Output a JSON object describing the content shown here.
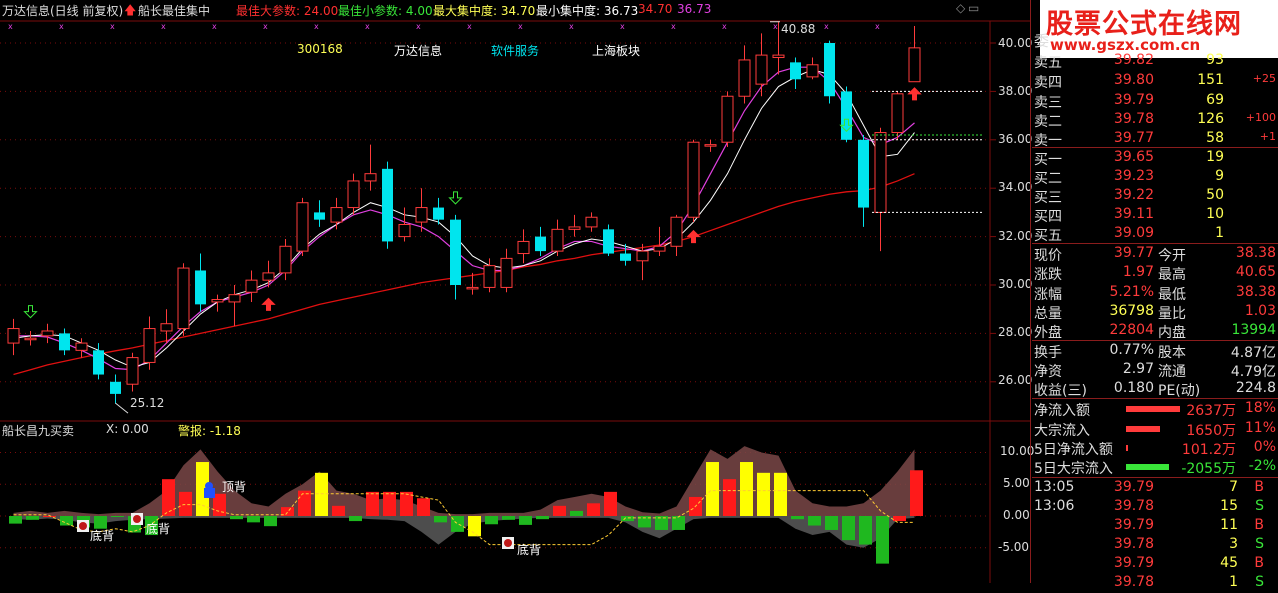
{
  "header": {
    "title": "万达信息(日线 前复权)",
    "formula": "船长最佳集中",
    "params": [
      {
        "label": "最佳大参数:",
        "value": "24.00",
        "color": "#ff3030"
      },
      {
        "label": "最佳小参数:",
        "value": "4.00",
        "color": "#39e639"
      },
      {
        "label": "最大集中度:",
        "value": "34.70",
        "color": "#ffff55"
      },
      {
        "label": "最小集中度:",
        "value": "36.73",
        "color": "#ffffff"
      }
    ],
    "extra_values": [
      "34.70",
      "36.73"
    ]
  },
  "info_row": {
    "code": "300168",
    "name": "万达信息",
    "industry": "软件服务",
    "region": "上海板块"
  },
  "price_labels": {
    "high": "40.88",
    "low": "25.12"
  },
  "y_axis_main": [
    "40.00",
    "38.00",
    "36.00",
    "34.00",
    "32.00",
    "30.00",
    "28.00",
    "26.00"
  ],
  "sub_chart": {
    "title": "船长昌九买卖",
    "x_label": "X: 0.00",
    "alert_label": "警报:",
    "alert_value": "-1.18",
    "y_axis": [
      "10.00",
      "5.00",
      "0.00",
      "-5.00"
    ],
    "annotations": {
      "top": "顶背",
      "bottom": "底背"
    }
  },
  "order_book": {
    "title": "委",
    "sells": [
      {
        "label": "卖五",
        "price": "39.82",
        "vol": "93",
        "chg": ""
      },
      {
        "label": "卖四",
        "price": "39.80",
        "vol": "151",
        "chg": "+25"
      },
      {
        "label": "卖三",
        "price": "39.79",
        "vol": "69",
        "chg": ""
      },
      {
        "label": "卖二",
        "price": "39.78",
        "vol": "126",
        "chg": "+100"
      },
      {
        "label": "卖一",
        "price": "39.77",
        "vol": "58",
        "chg": "+1"
      }
    ],
    "buys": [
      {
        "label": "买一",
        "price": "39.65",
        "vol": "19"
      },
      {
        "label": "买二",
        "price": "39.23",
        "vol": "9"
      },
      {
        "label": "买三",
        "price": "39.22",
        "vol": "50"
      },
      {
        "label": "买四",
        "price": "39.11",
        "vol": "10"
      },
      {
        "label": "买五",
        "price": "39.09",
        "vol": "1"
      }
    ]
  },
  "quote": [
    {
      "l1": "现价",
      "v1": "39.77",
      "l2": "今开",
      "v2": "38.38",
      "c1": "#ff3b3b",
      "c2": "#ff3b3b"
    },
    {
      "l1": "涨跌",
      "v1": "1.97",
      "l2": "最高",
      "v2": "40.65",
      "c1": "#ff3b3b",
      "c2": "#ff3b3b"
    },
    {
      "l1": "涨幅",
      "v1": "5.21%",
      "l2": "最低",
      "v2": "38.38",
      "c1": "#ff3b3b",
      "c2": "#ff3b3b"
    },
    {
      "l1": "总量",
      "v1": "36798",
      "l2": "量比",
      "v2": "1.03",
      "c1": "#ffff55",
      "c2": "#ff3b3b"
    },
    {
      "l1": "外盘",
      "v1": "22804",
      "l2": "内盘",
      "v2": "13994",
      "c1": "#ff3b3b",
      "c2": "#39e639"
    }
  ],
  "fundamentals": [
    {
      "l1": "换手",
      "v1": "0.77%",
      "l2": "股本",
      "v2": "4.87亿"
    },
    {
      "l1": "净资",
      "v1": "2.97",
      "l2": "流通",
      "v2": "4.79亿"
    },
    {
      "l1": "收益(三)",
      "v1": "0.180",
      "l2": "PE(动)",
      "v2": "224.8"
    }
  ],
  "flows": [
    {
      "label": "净流入额",
      "value": "2637万",
      "pct": "18%",
      "color": "#ff3b3b",
      "bar": 0.75
    },
    {
      "label": "大宗流入",
      "value": "1650万",
      "pct": "11%",
      "color": "#ff3b3b",
      "bar": 0.47
    },
    {
      "label": "5日净流入额",
      "value": "101.2万",
      "pct": "0%",
      "color": "#ff3b3b",
      "bar": 0.03
    },
    {
      "label": "5日大宗流入",
      "value": "-2055万",
      "pct": "-2%",
      "color": "#39e639",
      "bar": 0.6
    }
  ],
  "ticks": [
    {
      "time": "13:05",
      "price": "39.79",
      "vol": "7",
      "side": "B"
    },
    {
      "time": "13:06",
      "price": "39.78",
      "vol": "15",
      "side": "S"
    },
    {
      "time": "",
      "price": "39.79",
      "vol": "11",
      "side": "B"
    },
    {
      "time": "",
      "price": "39.78",
      "vol": "3",
      "side": "S"
    },
    {
      "time": "",
      "price": "39.79",
      "vol": "45",
      "side": "B"
    },
    {
      "time": "",
      "price": "39.78",
      "vol": "1",
      "side": "S"
    }
  ],
  "watermark": {
    "line1": "股票公式在线网",
    "line2": "www.gszx.com.cn"
  },
  "colors": {
    "up": "#ff3b3b",
    "down": "#00e5ee",
    "ma_long": "#e01010",
    "ma_short": "#ffffff",
    "ma_mid": "#e040e0",
    "grid": "#7a0c0c"
  },
  "chart_data": {
    "type": "candlestick",
    "y_range": [
      25.12,
      40.88
    ],
    "candles": [
      {
        "o": 27.6,
        "c": 28.2,
        "h": 28.6,
        "l": 27.1
      },
      {
        "o": 27.8,
        "c": 27.8,
        "h": 28.1,
        "l": 27.5
      },
      {
        "o": 27.9,
        "c": 28.1,
        "h": 28.4,
        "l": 27.6
      },
      {
        "o": 28.0,
        "c": 27.3,
        "h": 28.2,
        "l": 27.1
      },
      {
        "o": 27.3,
        "c": 27.6,
        "h": 27.8,
        "l": 27.0
      },
      {
        "o": 27.3,
        "c": 26.3,
        "h": 27.6,
        "l": 26.1
      },
      {
        "o": 26.0,
        "c": 25.5,
        "h": 26.3,
        "l": 25.1
      },
      {
        "o": 25.9,
        "c": 27.0,
        "h": 27.2,
        "l": 25.6
      },
      {
        "o": 26.8,
        "c": 28.2,
        "h": 28.7,
        "l": 26.5
      },
      {
        "o": 28.1,
        "c": 28.4,
        "h": 29.0,
        "l": 27.6
      },
      {
        "o": 28.2,
        "c": 30.7,
        "h": 30.9,
        "l": 27.9
      },
      {
        "o": 30.6,
        "c": 29.2,
        "h": 31.3,
        "l": 28.9
      },
      {
        "o": 29.3,
        "c": 29.4,
        "h": 29.6,
        "l": 28.9
      },
      {
        "o": 29.3,
        "c": 29.6,
        "h": 30.0,
        "l": 28.3
      },
      {
        "o": 29.7,
        "c": 30.2,
        "h": 30.6,
        "l": 29.3
      },
      {
        "o": 30.2,
        "c": 30.5,
        "h": 31.0,
        "l": 29.9
      },
      {
        "o": 30.5,
        "c": 31.6,
        "h": 31.9,
        "l": 30.2
      },
      {
        "o": 31.4,
        "c": 33.4,
        "h": 33.6,
        "l": 31.2
      },
      {
        "o": 33.0,
        "c": 32.7,
        "h": 33.5,
        "l": 32.4
      },
      {
        "o": 32.6,
        "c": 33.2,
        "h": 33.6,
        "l": 32.3
      },
      {
        "o": 33.2,
        "c": 34.3,
        "h": 34.6,
        "l": 32.9
      },
      {
        "o": 34.3,
        "c": 34.6,
        "h": 35.8,
        "l": 33.9
      },
      {
        "o": 34.8,
        "c": 31.8,
        "h": 35.1,
        "l": 31.5
      },
      {
        "o": 32.0,
        "c": 32.5,
        "h": 33.2,
        "l": 31.8
      },
      {
        "o": 32.6,
        "c": 33.2,
        "h": 34.0,
        "l": 32.2
      },
      {
        "o": 33.2,
        "c": 32.7,
        "h": 33.6,
        "l": 32.5
      },
      {
        "o": 32.7,
        "c": 30.0,
        "h": 32.9,
        "l": 29.4
      },
      {
        "o": 29.9,
        "c": 29.9,
        "h": 30.5,
        "l": 29.6
      },
      {
        "o": 29.9,
        "c": 30.8,
        "h": 31.1,
        "l": 29.7
      },
      {
        "o": 29.9,
        "c": 31.1,
        "h": 31.5,
        "l": 29.7
      },
      {
        "o": 31.3,
        "c": 31.8,
        "h": 32.3,
        "l": 30.9
      },
      {
        "o": 32.0,
        "c": 31.4,
        "h": 32.4,
        "l": 31.2
      },
      {
        "o": 31.4,
        "c": 32.3,
        "h": 32.7,
        "l": 31.2
      },
      {
        "o": 32.3,
        "c": 32.4,
        "h": 32.9,
        "l": 32.0
      },
      {
        "o": 32.4,
        "c": 32.8,
        "h": 33.0,
        "l": 32.2
      },
      {
        "o": 32.3,
        "c": 31.3,
        "h": 32.5,
        "l": 31.2
      },
      {
        "o": 31.3,
        "c": 31.0,
        "h": 31.7,
        "l": 30.8
      },
      {
        "o": 31.0,
        "c": 31.4,
        "h": 31.7,
        "l": 30.2
      },
      {
        "o": 31.4,
        "c": 31.6,
        "h": 32.4,
        "l": 31.2
      },
      {
        "o": 31.6,
        "c": 32.8,
        "h": 32.9,
        "l": 31.2
      },
      {
        "o": 32.8,
        "c": 35.9,
        "h": 36.0,
        "l": 32.6
      },
      {
        "o": 35.8,
        "c": 35.8,
        "h": 36.0,
        "l": 35.5
      },
      {
        "o": 35.9,
        "c": 37.8,
        "h": 38.0,
        "l": 35.7
      },
      {
        "o": 37.8,
        "c": 39.3,
        "h": 39.9,
        "l": 37.5
      },
      {
        "o": 38.3,
        "c": 39.5,
        "h": 40.4,
        "l": 37.8
      },
      {
        "o": 39.4,
        "c": 39.5,
        "h": 40.9,
        "l": 38.7
      },
      {
        "o": 39.2,
        "c": 38.5,
        "h": 39.4,
        "l": 38.1
      },
      {
        "o": 38.6,
        "c": 39.1,
        "h": 39.4,
        "l": 38.5
      },
      {
        "o": 40.0,
        "c": 37.8,
        "h": 40.1,
        "l": 37.5
      },
      {
        "o": 38.0,
        "c": 36.0,
        "h": 38.2,
        "l": 35.9
      },
      {
        "o": 36.0,
        "c": 33.2,
        "h": 36.2,
        "l": 32.4
      },
      {
        "o": 33.0,
        "c": 36.3,
        "h": 36.5,
        "l": 31.4
      },
      {
        "o": 36.3,
        "c": 37.9,
        "h": 38.0,
        "l": 36.0
      },
      {
        "o": 38.4,
        "c": 39.8,
        "h": 40.7,
        "l": 38.4
      }
    ],
    "ma_long": [
      26.3,
      26.5,
      26.7,
      26.85,
      27.0,
      27.15,
      27.28,
      27.4,
      27.55,
      27.7,
      27.85,
      28.0,
      28.15,
      28.3,
      28.45,
      28.6,
      28.8,
      29.0,
      29.2,
      29.35,
      29.5,
      29.65,
      29.8,
      29.95,
      30.1,
      30.2,
      30.3,
      30.4,
      30.5,
      30.6,
      30.75,
      30.85,
      31.0,
      31.1,
      31.25,
      31.35,
      31.45,
      31.55,
      31.65,
      31.8,
      32.0,
      32.25,
      32.5,
      32.75,
      33.0,
      33.25,
      33.45,
      33.6,
      33.75,
      33.85,
      33.9,
      34.05,
      34.3,
      34.6
    ],
    "ma_short": [
      27.8,
      27.9,
      27.95,
      27.9,
      27.6,
      27.3,
      26.9,
      26.6,
      26.8,
      27.4,
      28.1,
      28.8,
      29.3,
      29.6,
      29.8,
      30.1,
      30.7,
      31.5,
      32.1,
      32.5,
      33.0,
      33.4,
      33.2,
      32.9,
      32.8,
      32.6,
      32.0,
      31.2,
      30.8,
      30.7,
      30.8,
      31.0,
      31.4,
      31.7,
      31.9,
      31.8,
      31.6,
      31.4,
      31.5,
      31.9,
      32.6,
      33.5,
      34.6,
      36.0,
      37.3,
      38.2,
      38.6,
      38.9,
      38.7,
      37.9,
      36.6,
      35.3,
      35.4,
      36.3
    ],
    "ma_mid": [
      27.9,
      27.9,
      27.85,
      27.6,
      27.3,
      26.95,
      26.55,
      26.5,
      26.9,
      27.6,
      28.3,
      28.9,
      29.3,
      29.5,
      29.7,
      30.0,
      30.6,
      31.4,
      32.0,
      32.5,
      32.9,
      33.1,
      32.9,
      32.6,
      32.4,
      32.0,
      31.4,
      30.8,
      30.6,
      30.6,
      30.8,
      31.1,
      31.5,
      31.8,
      31.8,
      31.6,
      31.5,
      31.4,
      31.6,
      32.2,
      33.3,
      34.6,
      35.9,
      37.2,
      38.2,
      38.8,
      39.0,
      39.0,
      38.4,
      37.3,
      36.1,
      35.8,
      36.1,
      36.7
    ],
    "sub_bars": [
      -1.2,
      -0.6,
      0,
      -1.5,
      -1.8,
      -2.0,
      0,
      -2.6,
      -3.0,
      5.8,
      3.8,
      8.5,
      3.5,
      -0.5,
      -1.0,
      -1.6,
      1.4,
      4.0,
      6.8,
      1.6,
      -0.8,
      3.8,
      3.8,
      3.8,
      2.8,
      -1.0,
      -2.5,
      -3.2,
      -1.3,
      -0.6,
      -1.4,
      -0.5,
      1.6,
      0.8,
      2.0,
      3.8,
      -0.8,
      -1.8,
      -2.2,
      -2.2,
      3.0,
      8.5,
      5.8,
      8.5,
      6.8,
      6.8,
      -0.5,
      -1.5,
      -2.2,
      -3.8,
      -4.5,
      -7.5,
      -0.8,
      7.2
    ],
    "sub_bar_colors": [
      "down",
      "down",
      "up",
      "down",
      "down",
      "down",
      "down",
      "down",
      "down",
      "up",
      "up",
      "yellow",
      "up",
      "down",
      "down",
      "down",
      "up",
      "up",
      "yellow",
      "up",
      "down",
      "up",
      "up",
      "up",
      "up",
      "down",
      "down",
      "yellow",
      "down",
      "down",
      "down",
      "down",
      "up",
      "down",
      "up",
      "up",
      "down",
      "down",
      "down",
      "down",
      "up",
      "yellow",
      "up",
      "yellow",
      "yellow",
      "yellow",
      "down",
      "down",
      "down",
      "down",
      "down",
      "down",
      "up",
      "up"
    ]
  }
}
